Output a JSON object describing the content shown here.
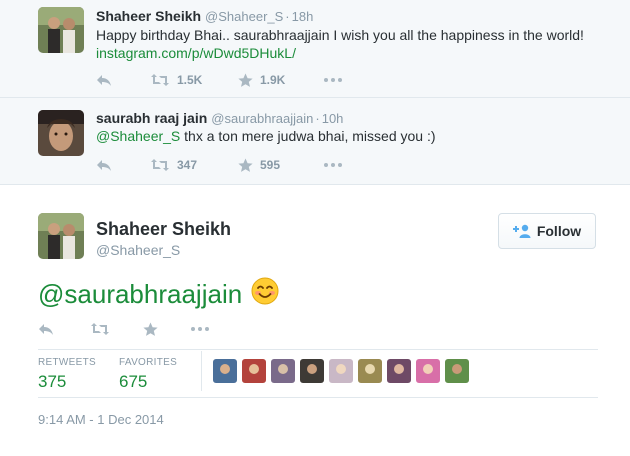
{
  "context_tweets": [
    {
      "name": "Shaheer Sheikh",
      "handle": "@Shaheer_S",
      "time": "18h",
      "text_line1": "Happy birthday Bhai.. saurabhraajjain I wish you all the happiness in the world!",
      "link": "instagram.com/p/wDwd5DHukL/",
      "retweets": "1.5K",
      "favorites": "1.9K"
    },
    {
      "name": "saurabh raaj jain",
      "handle": "@saurabhraajjain",
      "time": "10h",
      "mention": "@Shaheer_S",
      "text_rest": " thx a ton mere judwa bhai, missed you :)",
      "retweets": "347",
      "favorites": "595"
    }
  ],
  "main_tweet": {
    "name": "Shaheer Sheikh",
    "handle": "@Shaheer_S",
    "follow_label": "Follow",
    "text": "@saurabhraajjain",
    "emoji": "smiling-face-emoji",
    "retweets_label": "RETWEETS",
    "retweets": "375",
    "favorites_label": "FAVORITES",
    "favorites": "675",
    "timestamp": "9:14 AM - 1 Dec 2014",
    "favoriter_avatar_count": 9
  },
  "colors": {
    "link_green": "#1b8c3a",
    "muted": "#8899a6",
    "icon_gray": "#aab8c2",
    "context_bg": "#f5f8fa",
    "follow_icon_blue": "#55acee"
  },
  "icons": [
    "reply-icon",
    "retweet-icon",
    "favorite-star-icon",
    "more-dots-icon",
    "follow-person-icon"
  ]
}
